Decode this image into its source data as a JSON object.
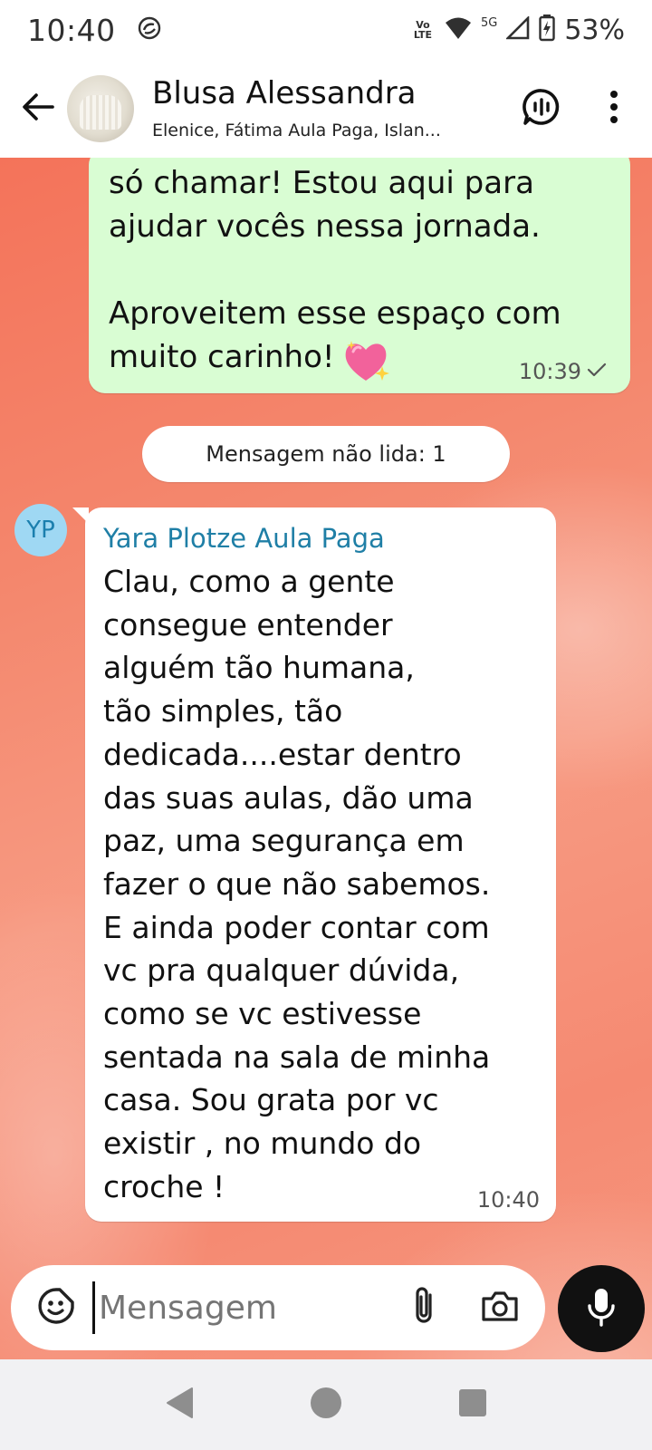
{
  "status_bar": {
    "time": "10:40",
    "volte_label": "Vo LTE",
    "network_label": "5G",
    "battery_percent": "53%"
  },
  "header": {
    "title": "Blusa Alessandra",
    "subtitle": "Elenice, Fátima Aula Paga, Islan..."
  },
  "messages": {
    "outgoing": {
      "text": "só chamar! Estou aqui para\najudar vocês nessa jornada.\n\nAproveitem esse espaço com\nmuito carinho!",
      "time": "10:39",
      "status": "sent"
    },
    "unread_divider": "Mensagem não lida: 1",
    "incoming": {
      "avatar_initials": "YP",
      "sender": "Yara Plotze Aula Paga",
      "text": "Clau, como a gente\nconsegue entender\nalguém tão humana,\ntão simples, tão\ndedicada....estar dentro\ndas suas aulas, dão uma\npaz, uma segurança em\nfazer o que não sabemos.\nE ainda poder contar com\nvc pra qualquer dúvida,\ncomo se vc estivesse\nsentada na sala de minha\ncasa. Sou grata por vc\nexistir , no mundo do\ncroche !",
      "time": "10:40"
    }
  },
  "composer": {
    "placeholder": "Mensagem"
  },
  "colors": {
    "outgoing_bubble": "#d9fdd3",
    "incoming_bubble": "#ffffff",
    "sender_name": "#1f7fa6",
    "mic_button": "#111111"
  },
  "icons": {
    "back": "arrow-left-icon",
    "call": "voice-chat-icon",
    "menu": "more-vertical-icon",
    "emoji": "sticker-icon",
    "attach": "paperclip-icon",
    "camera": "camera-icon",
    "mic": "microphone-icon"
  }
}
